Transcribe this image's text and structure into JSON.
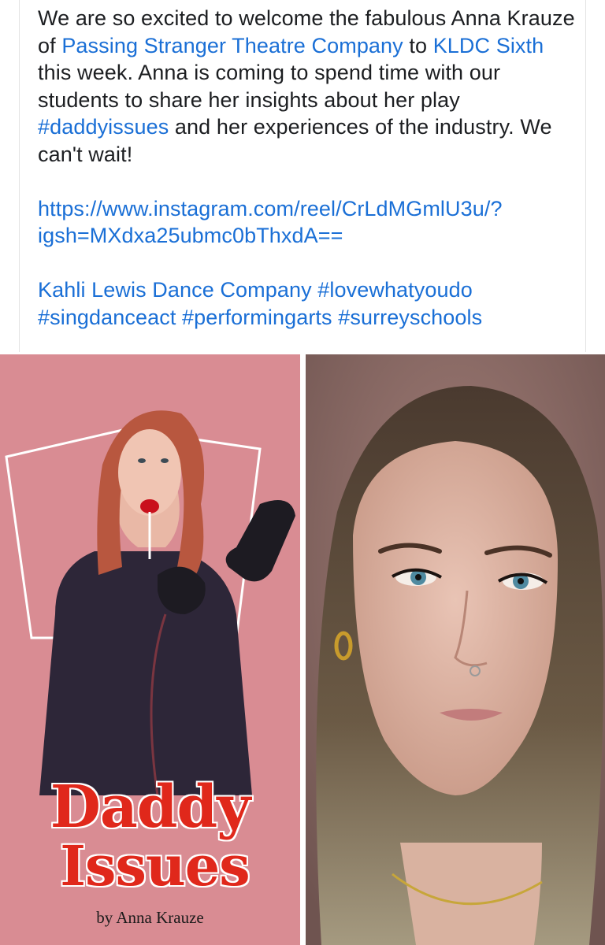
{
  "post": {
    "para1_intro": "We are so excited to welcome the fabulous Anna Krauze of ",
    "para1_link1": "Passing Stranger Theatre Company",
    "para1_to": " to ",
    "para1_link2": "KLDC Sixth",
    "para1_mid": " this week. Anna is coming to spend time with our students to share her insights about her play ",
    "para1_hashtag": "#daddyissues",
    "para1_end": " and her experiences of the industry.  We can't wait!",
    "url_line1": "https://www.instagram.com/reel/CrLdMGmlU3u/?",
    "url_line2": "igsh=MXdxa25ubmc0bThxdA==",
    "tag_line1_mention": "Kahli Lewis Dance Company",
    "tag_line1_hashtag": "#lovewhatyoudo",
    "tag_line2_h1": "#singdanceact",
    "tag_line2_h2": "#performingarts",
    "tag_line2_h3": "#surreyschools"
  },
  "poster": {
    "title_line1": "Daddy",
    "title_line2": "Issues",
    "byline": "by Anna Krauze"
  },
  "colors": {
    "link": "#1a6fd6",
    "text": "#1c1e21",
    "poster_bg": "#d98c93",
    "poster_title": "#e0281b"
  }
}
